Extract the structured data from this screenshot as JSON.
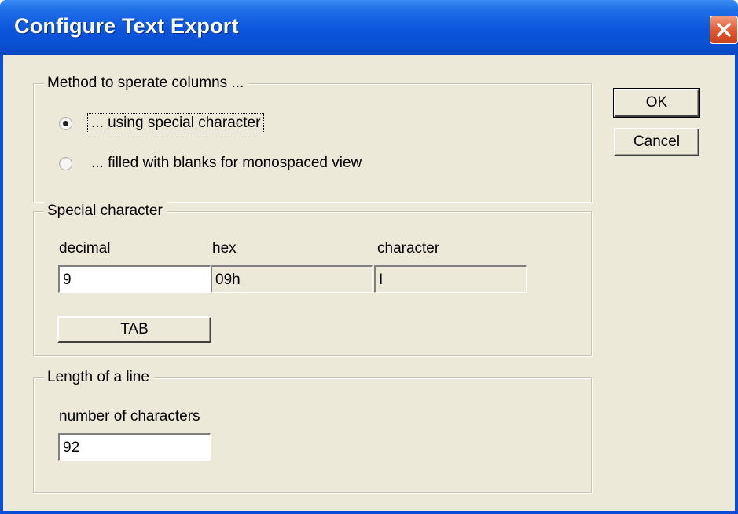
{
  "window": {
    "title": "Configure Text Export"
  },
  "buttons": {
    "ok": "OK",
    "cancel": "Cancel",
    "tab": "TAB"
  },
  "columns_group": {
    "legend": "Method to sperate columns ...",
    "options": [
      {
        "label": "... using special character",
        "checked": true
      },
      {
        "label": "... filled with blanks for monospaced view",
        "checked": false
      }
    ]
  },
  "special_group": {
    "legend": "Special character",
    "decimal_label": "decimal",
    "hex_label": "hex",
    "character_label": "character",
    "decimal_value": "9",
    "hex_value": "09h",
    "character_value": "I"
  },
  "line_group": {
    "legend": "Length of a line",
    "chars_label": "number of characters",
    "chars_value": "92"
  },
  "icons": {
    "close": "close-icon"
  },
  "colors": {
    "titlebar": "#0a4ed6",
    "close": "#e0562f",
    "dialog_bg": "#ece9d8"
  }
}
